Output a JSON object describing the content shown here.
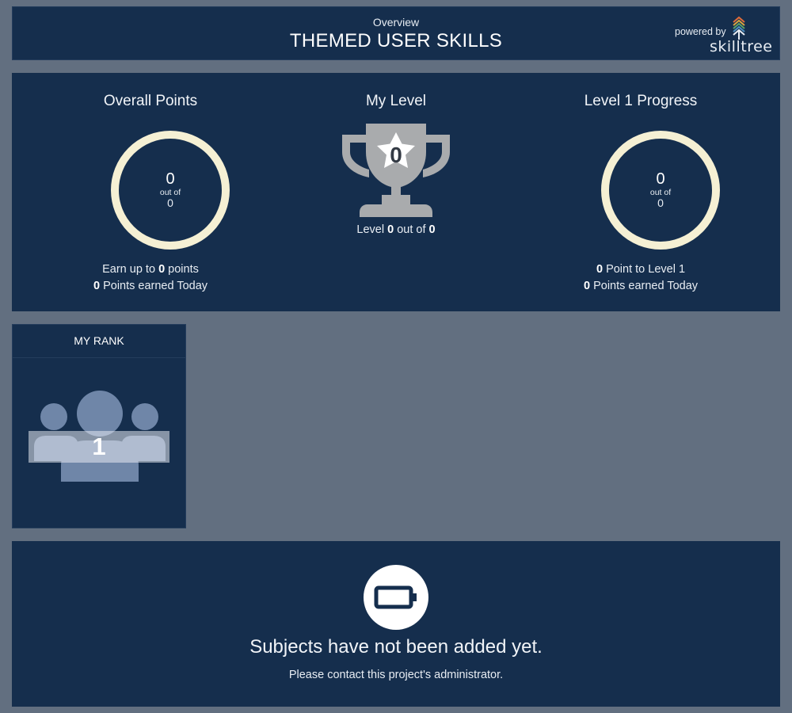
{
  "header": {
    "breadcrumb": "Overview",
    "title": "THEMED USER SKILLS",
    "powered_by": "powered by",
    "logo_text": "skilltree"
  },
  "overall_points": {
    "title": "Overall Points",
    "value": "0",
    "out_of_label": "out of",
    "total": "0",
    "earn_prefix": "Earn up to",
    "earn_value": "0",
    "earn_suffix": "points",
    "today_value": "0",
    "today_label": "Points earned Today",
    "progress_fraction": 0
  },
  "my_level": {
    "title": "My Level",
    "trophy_level": "0",
    "level_prefix": "Level",
    "level_value": "0",
    "level_mid": "out of",
    "level_total": "0",
    "icon": "trophy-icon"
  },
  "level_progress": {
    "title": "Level 1 Progress",
    "value": "0",
    "out_of_label": "out of",
    "total": "0",
    "to_level_value": "0",
    "to_level_label": "Point to Level 1",
    "today_value": "0",
    "today_label": "Points earned Today",
    "progress_fraction": 0
  },
  "rank": {
    "title": "MY RANK",
    "value": "1",
    "icon": "users-icon"
  },
  "subjects": {
    "icon": "battery-empty-icon",
    "empty_title": "Subjects have not been added yet.",
    "empty_subtitle": "Please contact this project's administrator."
  },
  "colors": {
    "page_background": "#626f80",
    "panel_background": "#152e4d",
    "ring_color": "#f5f0d4",
    "trophy_color": "#a9abad",
    "rank_icon_color": "#6f86a8"
  }
}
